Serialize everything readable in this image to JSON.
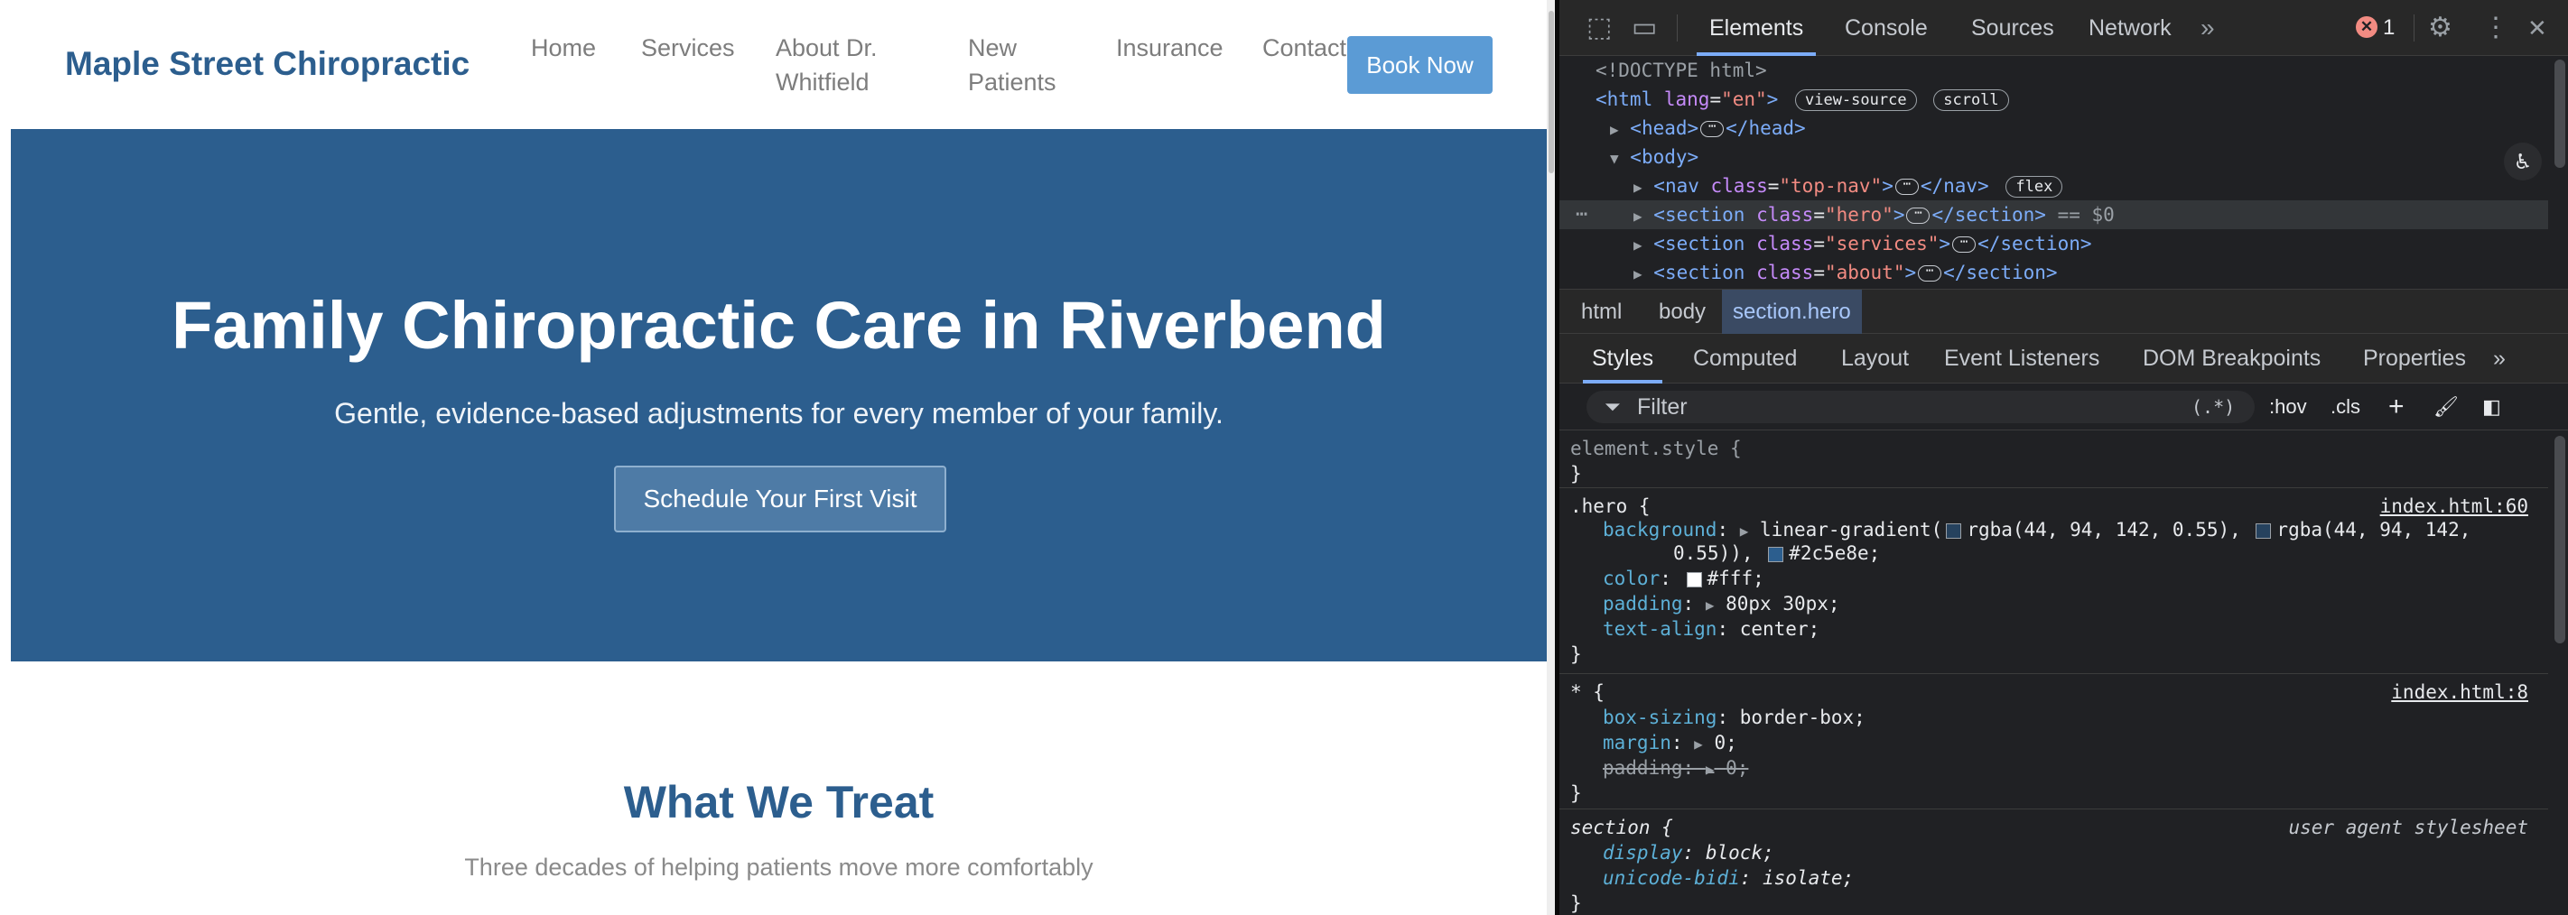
{
  "site": {
    "brand": "Maple Street Chiropractic",
    "nav": [
      "Home",
      "Services",
      "About Dr. Whitfield",
      "New Patients",
      "Insurance",
      "Contact"
    ],
    "nav_display": {
      "about_line1": "About Dr.",
      "about_line2": "Whitfield",
      "new_line1": "New",
      "new_line2": "Patients"
    },
    "book_button": "Book Now",
    "hero": {
      "title": "Family Chiropractic Care in Riverbend",
      "subtitle": "Gentle, evidence-based adjustments for every member of your family.",
      "cta": "Schedule Your First Visit"
    },
    "services": {
      "title": "What We Treat",
      "subtitle": "Three decades of helping patients move more comfortably"
    },
    "colors": {
      "brand": "#2c5e8e",
      "button": "#5b9bd5",
      "muted": "#7d7d7d"
    }
  },
  "devtools": {
    "tabs": [
      "Elements",
      "Console",
      "Sources",
      "Network"
    ],
    "active_tab": "Elements",
    "error_count": "1",
    "dom": {
      "doctype": "<!DOCTYPE html>",
      "html_open": "<html",
      "html_lang_attr": " lang",
      "html_lang_val": "\"en\"",
      "html_close_bracket": ">",
      "pill_view_source": "view-source",
      "pill_scroll": "scroll",
      "head_open": "<head>",
      "head_close": "</head>",
      "body_open": "<body>",
      "nav_open": "<nav",
      "nav_class_val": "\"top-nav\"",
      "nav_close": "</nav>",
      "pill_flex": "flex",
      "hero_class_val": "\"hero\"",
      "services_class_val": "\"services\"",
      "about_class_val": "\"about\"",
      "section_open": "<section",
      "section_close": "</section>",
      "class_attr": " class",
      "selected_marker": "== $0"
    },
    "breadcrumbs": [
      "html",
      "body",
      "section.hero"
    ],
    "subtabs": [
      "Styles",
      "Computed",
      "Layout",
      "Event Listeners",
      "DOM Breakpoints",
      "Properties"
    ],
    "filter": {
      "placeholder": "Filter",
      "regex_toggle": "(.*)",
      "hov": ":hov",
      "cls": ".cls"
    },
    "styles": {
      "element_style": "element.style {",
      "hero_selector": ".hero {",
      "hero_source": "index.html:60",
      "hero_bg_prop": "background",
      "hero_bg_val_1": "linear-gradient(",
      "hero_bg_rgba": "rgba(44, 94, 142, 0.55),",
      "hero_bg_rgba_2": "rgba(44, 94, 142,",
      "hero_bg_val_2": "0.55)),",
      "hero_bg_hex": "#2c5e8e;",
      "hero_color_prop": "color",
      "hero_color_val": "#fff;",
      "hero_padding_prop": "padding",
      "hero_padding_val": "80px 30px;",
      "hero_align_prop": "text-align",
      "hero_align_val": "center;",
      "star_selector": "* {",
      "star_source": "index.html:8",
      "boxsizing_prop": "box-sizing",
      "boxsizing_val": "border-box;",
      "margin_prop": "margin",
      "margin_val": "0;",
      "padding_prop": "padding",
      "padding_val": "0;",
      "section_selector": "section {",
      "section_source": "user agent stylesheet",
      "display_prop": "display",
      "display_val": "block;",
      "unicode_prop": "unicode-bidi",
      "unicode_val": "isolate;",
      "close_brace": "}"
    }
  }
}
